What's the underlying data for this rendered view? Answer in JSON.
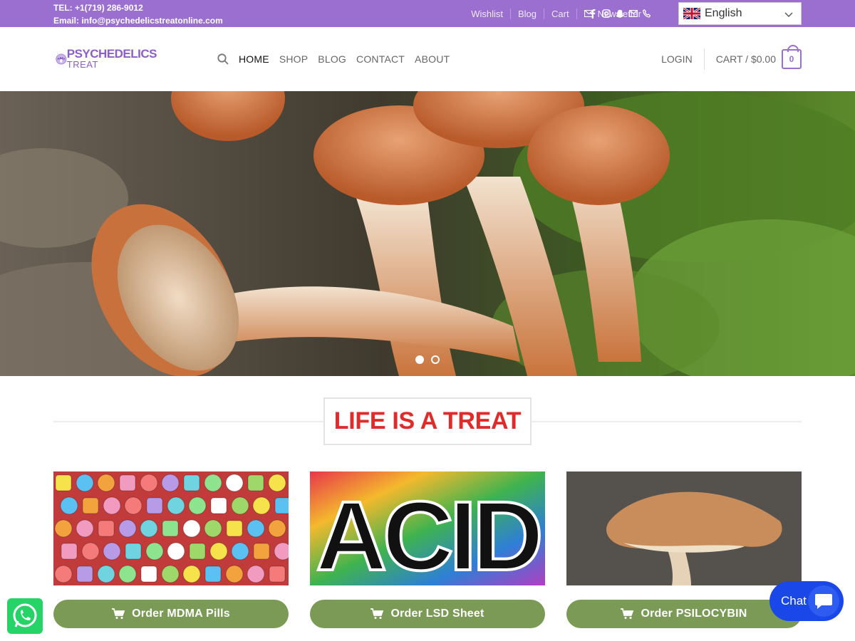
{
  "topbar": {
    "tel": "TEL: +1(719) 286-9012",
    "email": "Email: info@psychedelicstreatonline.com",
    "links": [
      "Wishlist",
      "Blog",
      "Cart",
      "Newsletter"
    ],
    "background": "#9a6fd0",
    "social_icons": [
      "facebook-icon",
      "instagram-icon",
      "snapchat-icon",
      "mail-icon",
      "phone-icon"
    ],
    "language": "English"
  },
  "header": {
    "logo_line1": "PSYCHEDELICS",
    "logo_line2": "TREAT",
    "nav": [
      "HOME",
      "SHOP",
      "BLOG",
      "CONTACT",
      "ABOUT"
    ],
    "login": "LOGIN",
    "cart_label": "CART / $0.00",
    "cart_count": "0"
  },
  "hero": {
    "slides": 2,
    "active_slide": 1
  },
  "section": {
    "title": "LIFE IS A TREAT",
    "title_color": "#e02b2b"
  },
  "products": [
    {
      "button": "Order MDMA Pills"
    },
    {
      "button": "Order LSD Sheet",
      "image_text": "ACID"
    },
    {
      "button": "Order PSILOCYBIN"
    }
  ],
  "button_color": "#7b9a56",
  "chat": {
    "label": "Chat",
    "color": "#1a47e8"
  }
}
